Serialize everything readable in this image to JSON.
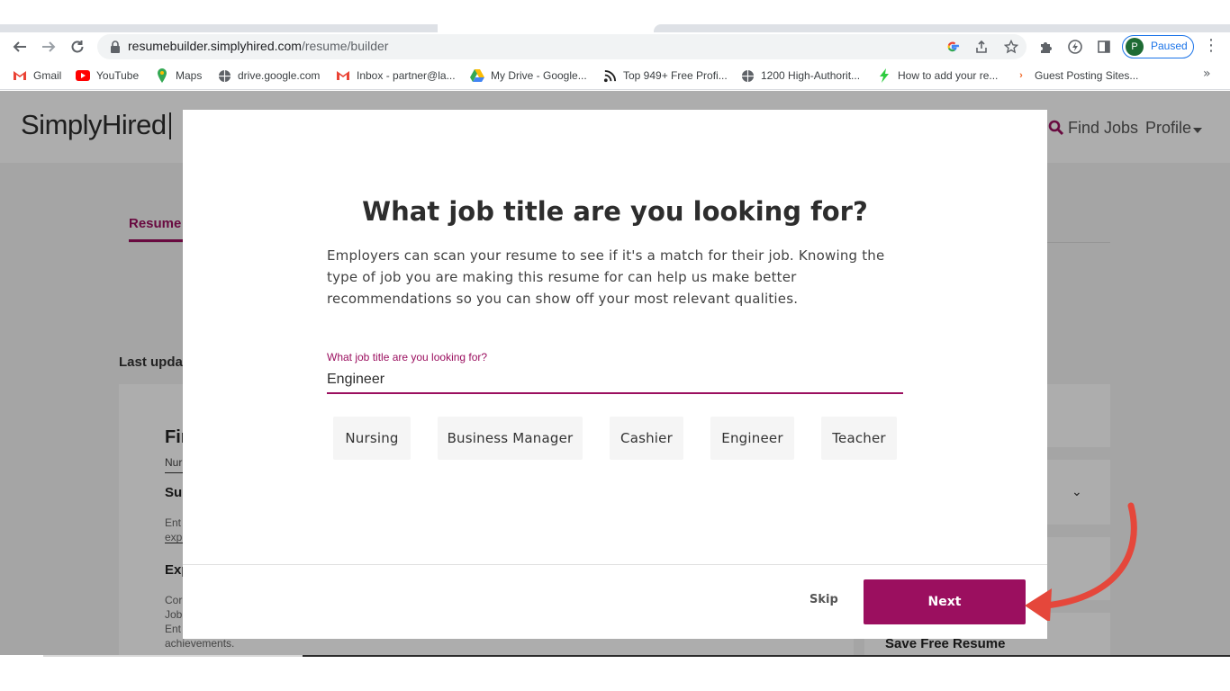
{
  "browser": {
    "url_host": "resumebuilder.simplyhired.com",
    "url_path": "/resume/builder",
    "profile_initial": "P",
    "profile_status": "Paused",
    "icons": [
      "back-icon",
      "forward-icon",
      "reload-icon",
      "lock-icon",
      "google-icon",
      "share-icon",
      "star-icon",
      "extensions-icon",
      "performance-icon",
      "side-panel-icon",
      "menu-icon"
    ]
  },
  "bookmarks": [
    {
      "label": "Gmail",
      "icon": "gmail-icon"
    },
    {
      "label": "YouTube",
      "icon": "youtube-icon"
    },
    {
      "label": "Maps",
      "icon": "maps-icon"
    },
    {
      "label": "drive.google.com",
      "icon": "globe-icon"
    },
    {
      "label": "Inbox - partner@la...",
      "icon": "gmail-icon"
    },
    {
      "label": "My Drive - Google...",
      "icon": "drive-icon"
    },
    {
      "label": "Top 949+ Free Profi...",
      "icon": "feed-icon"
    },
    {
      "label": "1200 High-Authorit...",
      "icon": "globe-icon"
    },
    {
      "label": "How to add your re...",
      "icon": "bolt-icon"
    },
    {
      "label": "Guest Posting Sites...",
      "icon": "site-icon"
    }
  ],
  "site": {
    "logo": "SimplyHired",
    "find_jobs": "Find Jobs",
    "profile": "Profile",
    "tab_resume": "Resume",
    "last_updated": "Last upda",
    "save_free_resume": "Save Free Resume"
  },
  "resume_preview": {
    "name": "Fir",
    "subtitle": "Nur",
    "section1_heading": "Su",
    "section1_text": [
      "Ent",
      "exp"
    ],
    "section2_heading": "Exp",
    "section2_text": [
      "Cor",
      "Job",
      "Ent",
      "achievements."
    ]
  },
  "modal": {
    "title": "What job title are you looking for?",
    "description": "Employers can scan your resume to see if it's a match for their job. Knowing the type of job you are making this resume for can help us make better recommendations so you can show off your most relevant qualities.",
    "field_label": "What job title are you looking for?",
    "field_value": "Engineer",
    "suggestions": [
      "Nursing",
      "Business Manager",
      "Cashier",
      "Engineer",
      "Teacher"
    ],
    "skip_label": "Skip",
    "next_label": "Next"
  },
  "colors": {
    "brand": "#9b0f5f",
    "annotation_arrow": "#e5473b"
  }
}
